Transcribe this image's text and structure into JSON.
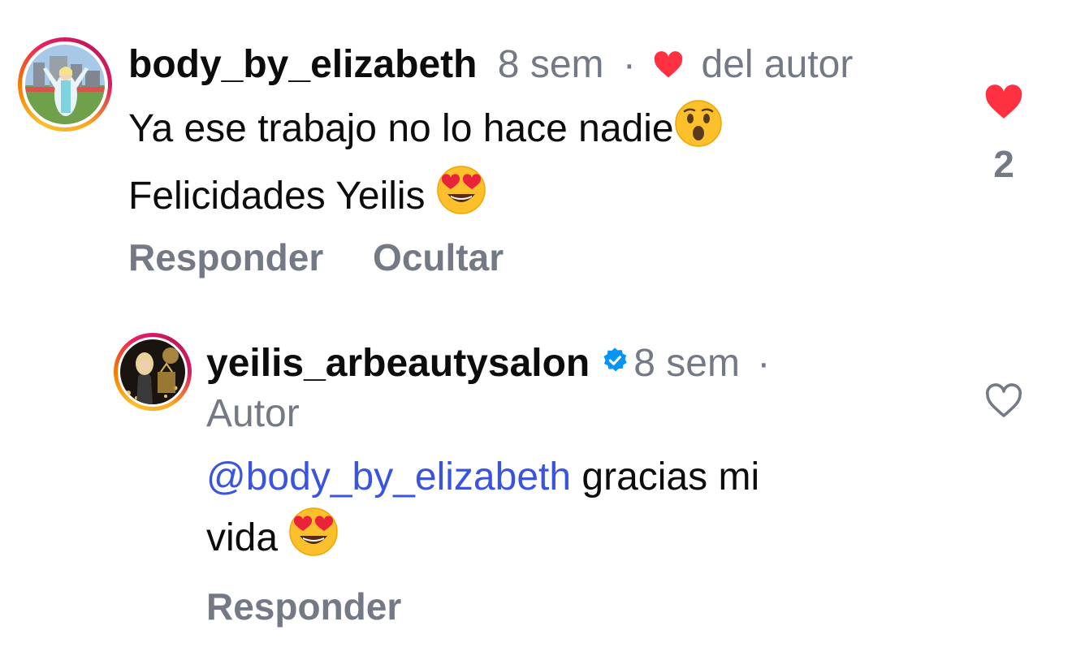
{
  "comments": [
    {
      "username": "body_by_elizabeth",
      "time": "8 sem",
      "separator": "·",
      "author_liked": "del autor",
      "text_line1": "Ya ese trabajo no lo hace nadie",
      "text_line2": "Felicidades Yeilis",
      "actions": {
        "reply": "Responder",
        "hide": "Ocultar"
      },
      "likes": "2",
      "liked": true
    },
    {
      "username": "yeilis_arbeautysalon",
      "verified": true,
      "time": "8 sem",
      "separator": "·",
      "role": "Autor",
      "mention": "@body_by_elizabeth",
      "text_part1": "gracias mi",
      "text_line2": "vida",
      "actions": {
        "reply": "Responder"
      },
      "liked": false
    }
  ],
  "icons": {
    "like_filled": "heart-filled-icon",
    "like_outline": "heart-outline-icon",
    "verified": "verified-badge-icon",
    "emoji_surprised": "surprised-face-emoji",
    "emoji_heart_eyes": "heart-eyes-emoji"
  },
  "colors": {
    "like_red": "#ff3040",
    "mention_blue": "#3a54e0",
    "muted_gray": "#737a85",
    "verified_blue": "#0095f6"
  }
}
